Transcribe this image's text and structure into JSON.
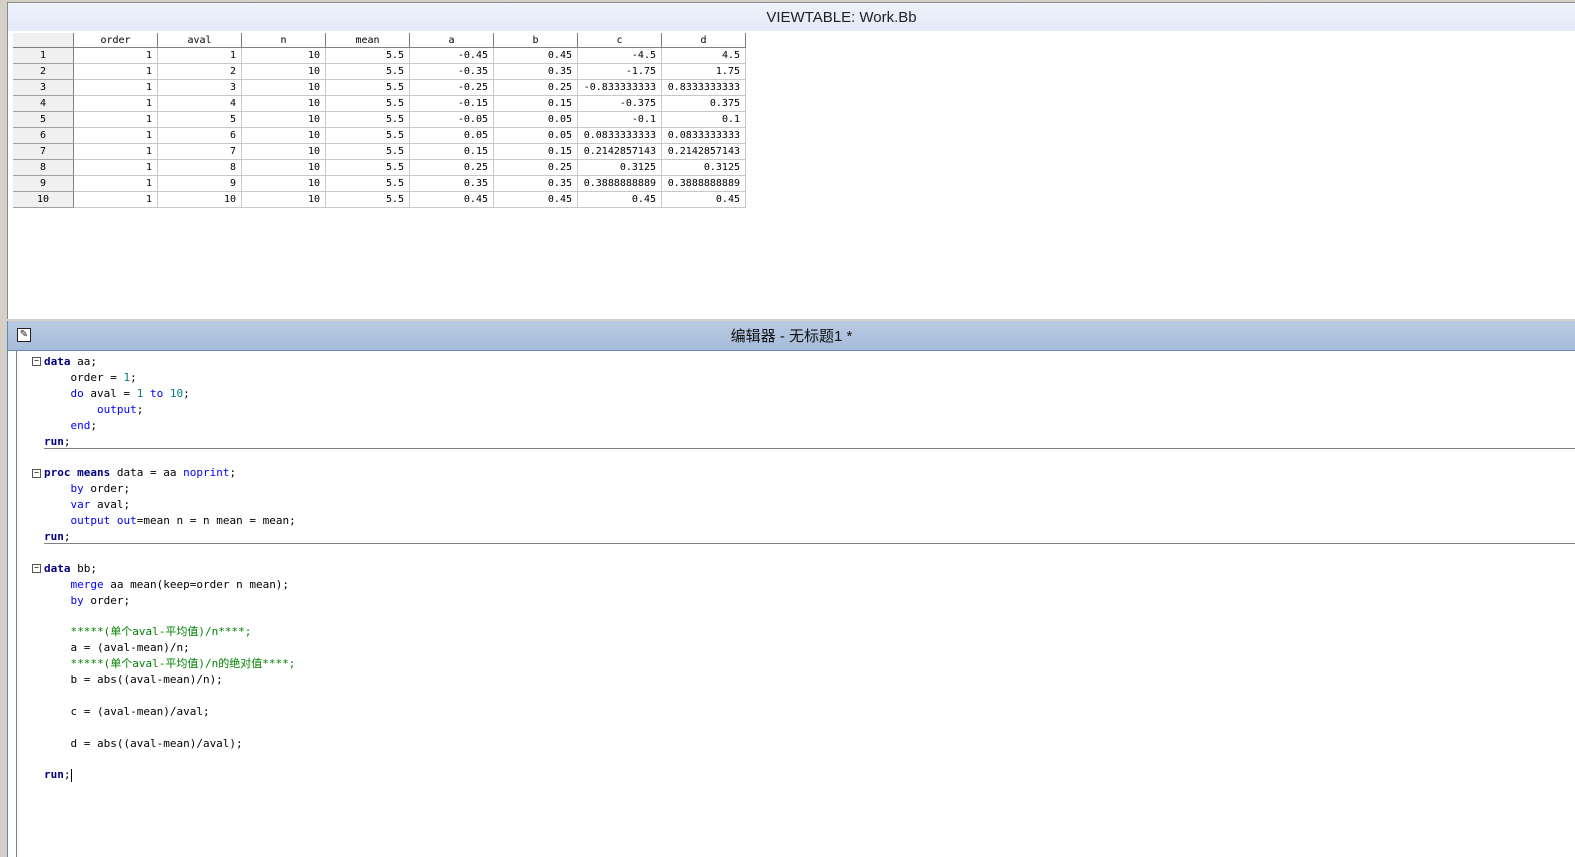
{
  "viewtable": {
    "title": "VIEWTABLE: Work.Bb",
    "columns": [
      "order",
      "aval",
      "n",
      "mean",
      "a",
      "b",
      "c",
      "d"
    ],
    "rows": [
      [
        "1",
        "1",
        "1",
        "10",
        "5.5",
        "-0.45",
        "0.45",
        "-4.5",
        "4.5"
      ],
      [
        "2",
        "1",
        "2",
        "10",
        "5.5",
        "-0.35",
        "0.35",
        "-1.75",
        "1.75"
      ],
      [
        "3",
        "1",
        "3",
        "10",
        "5.5",
        "-0.25",
        "0.25",
        "-0.833333333",
        "0.8333333333"
      ],
      [
        "4",
        "1",
        "4",
        "10",
        "5.5",
        "-0.15",
        "0.15",
        "-0.375",
        "0.375"
      ],
      [
        "5",
        "1",
        "5",
        "10",
        "5.5",
        "-0.05",
        "0.05",
        "-0.1",
        "0.1"
      ],
      [
        "6",
        "1",
        "6",
        "10",
        "5.5",
        "0.05",
        "0.05",
        "0.0833333333",
        "0.0833333333"
      ],
      [
        "7",
        "1",
        "7",
        "10",
        "5.5",
        "0.15",
        "0.15",
        "0.2142857143",
        "0.2142857143"
      ],
      [
        "8",
        "1",
        "8",
        "10",
        "5.5",
        "0.25",
        "0.25",
        "0.3125",
        "0.3125"
      ],
      [
        "9",
        "1",
        "9",
        "10",
        "5.5",
        "0.35",
        "0.35",
        "0.3888888889",
        "0.3888888889"
      ],
      [
        "10",
        "1",
        "10",
        "10",
        "5.5",
        "0.45",
        "0.45",
        "0.45",
        "0.45"
      ]
    ]
  },
  "editor": {
    "title": "编辑器 - 无标题1 *",
    "icon": "editor-icon",
    "lines": [
      "data aa;",
      "    order = 1;",
      "    do aval = 1 to 10;",
      "        output;",
      "    end;",
      "run;",
      "",
      "proc means data = aa noprint;",
      "    by order;",
      "    var aval;",
      "    output out=mean n = n mean = mean;",
      "run;",
      "",
      "data bb;",
      "    merge aa mean(keep=order n mean);",
      "    by order;",
      "",
      "    *****(单个aval-平均值)/n****;",
      "    a = (aval-mean)/n;",
      "    *****(单个aval-平均值)/n的绝对值****;",
      "    b = abs((aval-mean)/n);",
      "",
      "    c = (aval-mean)/aval;",
      "",
      "    d = abs((aval-mean)/aval);",
      "",
      "run;"
    ]
  }
}
